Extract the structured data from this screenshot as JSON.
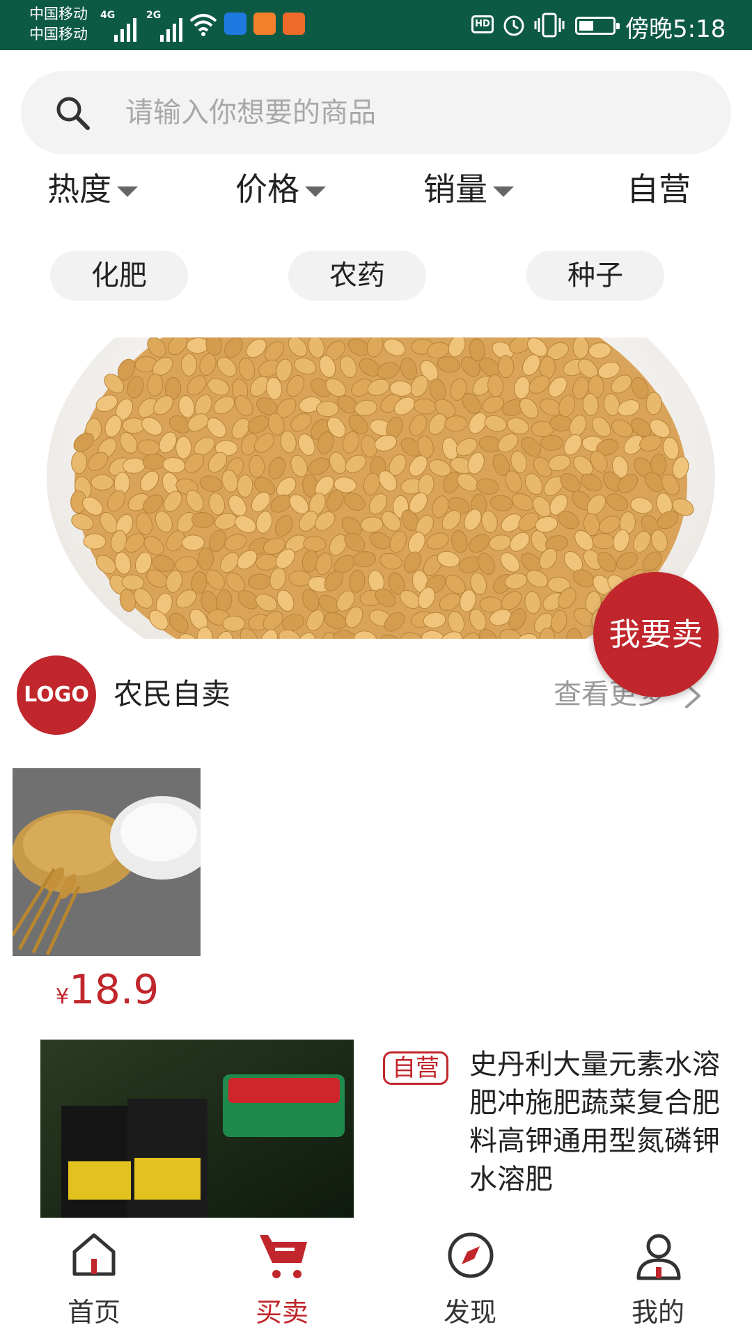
{
  "status_bar": {
    "carrier1": "中国移动",
    "carrier2": "中国移动",
    "net1": "4G",
    "net2": "2G",
    "hd": "HD",
    "time": "傍晚5:18"
  },
  "search": {
    "placeholder": "请输入你想要的商品"
  },
  "filters": [
    "热度",
    "价格",
    "销量",
    "自营"
  ],
  "categories": [
    "化肥",
    "农药",
    "种子"
  ],
  "fab": {
    "label": "我要卖"
  },
  "section": {
    "logo": "LOGO",
    "title": "农民自卖",
    "more": "查看更多"
  },
  "product1": {
    "currency": "¥",
    "price": "18.9"
  },
  "product2": {
    "badge": "自营",
    "title": "史丹利大量元素水溶肥冲施肥蔬菜复合肥料高钾通用型氮磷钾水溶肥"
  },
  "nav": {
    "items": [
      {
        "label": "首页",
        "icon": "home-icon"
      },
      {
        "label": "买卖",
        "icon": "cart-icon"
      },
      {
        "label": "发现",
        "icon": "compass-icon"
      },
      {
        "label": "我的",
        "icon": "profile-icon"
      }
    ],
    "active_index": 1
  },
  "colors": {
    "status_bar": "#0d5a44",
    "accent": "#c0262b"
  }
}
